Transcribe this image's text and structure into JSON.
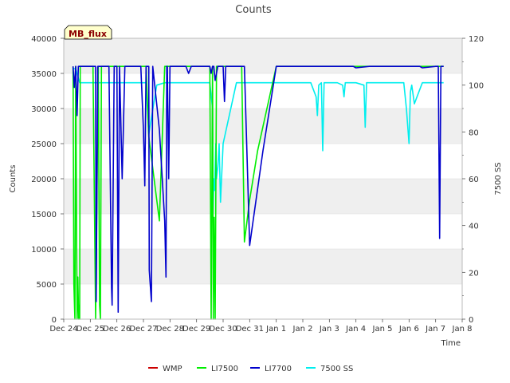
{
  "chart_data": {
    "type": "line",
    "title": "Counts",
    "xlabel": "Time",
    "ylabel": "Counts",
    "y2label": "7500 SS",
    "badge": "MB_flux",
    "x_ticks": [
      "Dec 24",
      "Dec 25",
      "Dec 26",
      "Dec 27",
      "Dec 28",
      "Dec 29",
      "Dec 30",
      "Dec 31",
      "Jan 1",
      "Jan 2",
      "Jan 3",
      "Jan 4",
      "Jan 5",
      "Jan 6",
      "Jan 7",
      "Jan 8"
    ],
    "x_range_days": [
      0,
      15
    ],
    "ylim": [
      0,
      40000
    ],
    "y_ticks": [
      0,
      5000,
      10000,
      15000,
      20000,
      25000,
      30000,
      35000,
      40000
    ],
    "y2lim": [
      0,
      120
    ],
    "y2_ticks": [
      0,
      20,
      40,
      60,
      80,
      100,
      120
    ],
    "grid": "horizontal bands",
    "legend_position": "bottom",
    "series": [
      {
        "name": "WMP",
        "color": "#cc0000",
        "axis": "left",
        "x": [],
        "values": []
      },
      {
        "name": "LI7500",
        "color": "#00ee00",
        "axis": "left",
        "x": [
          0.35,
          0.38,
          0.42,
          0.45,
          0.5,
          0.53,
          0.56,
          0.58,
          0.6,
          0.62,
          0.65,
          0.7,
          0.72,
          0.75,
          0.8,
          0.9,
          1.0,
          1.1,
          1.2,
          1.3,
          1.35,
          1.38,
          1.42,
          1.45,
          1.5,
          1.55,
          1.6,
          1.7,
          1.9,
          2.2,
          2.6,
          3.0,
          3.05,
          3.1,
          3.2,
          3.6,
          3.8,
          3.85,
          3.9,
          4.0,
          4.2,
          4.6,
          5.0,
          5.2,
          5.5,
          5.55,
          5.6,
          5.63,
          5.66,
          5.7,
          5.75,
          5.8,
          5.85,
          5.9,
          5.95,
          6.0,
          6.2,
          6.7,
          6.8,
          7.0,
          7.3,
          8.0,
          9.0,
          10.0,
          11.0,
          12.0,
          13.0,
          14.0,
          14.3
        ],
        "values": [
          36000,
          5000,
          0,
          36000,
          0,
          6000,
          0,
          2000,
          0,
          36000,
          36000,
          36000,
          36000,
          36000,
          36000,
          36000,
          36000,
          36000,
          0,
          36000,
          2000,
          0,
          36000,
          36000,
          36000,
          36000,
          36000,
          36000,
          36000,
          36000,
          36000,
          36000,
          36000,
          36000,
          26000,
          14000,
          36000,
          36000,
          36000,
          36000,
          36000,
          36000,
          36000,
          36000,
          36000,
          0,
          36000,
          0,
          14500,
          0,
          36000,
          36000,
          36000,
          36000,
          36000,
          36000,
          36000,
          36000,
          11000,
          17000,
          24000,
          36000,
          36000,
          36000,
          36000,
          36000,
          36000,
          36000,
          36000
        ]
      },
      {
        "name": "LI7700",
        "color": "#0000cc",
        "axis": "left",
        "x": [
          0.35,
          0.4,
          0.45,
          0.5,
          0.55,
          0.6,
          0.65,
          0.7,
          0.8,
          1.0,
          1.1,
          1.2,
          1.22,
          1.28,
          1.35,
          1.6,
          1.7,
          1.8,
          1.82,
          1.9,
          2.0,
          2.05,
          2.1,
          2.2,
          2.3,
          2.35,
          2.4,
          2.6,
          2.9,
          3.0,
          3.05,
          3.1,
          3.12,
          3.15,
          3.2,
          3.22,
          3.3,
          3.35,
          3.6,
          3.8,
          3.85,
          3.88,
          3.9,
          3.95,
          4.0,
          4.2,
          4.6,
          4.7,
          4.8,
          5.0,
          5.2,
          5.5,
          5.55,
          5.6,
          5.65,
          5.7,
          5.8,
          5.9,
          6.0,
          6.05,
          6.1,
          6.2,
          6.4,
          6.6,
          6.8,
          7.0,
          7.5,
          8.0,
          9.0,
          10.0,
          10.9,
          11.0,
          11.5,
          12.0,
          13.0,
          13.4,
          13.5,
          14.0,
          14.1,
          14.15,
          14.2,
          14.3
        ],
        "values": [
          36000,
          33000,
          36000,
          29000,
          36000,
          36000,
          36000,
          36000,
          36000,
          36000,
          36000,
          36000,
          2500,
          36000,
          36000,
          36000,
          36000,
          4500,
          2000,
          36000,
          36000,
          1000,
          36000,
          20000,
          36000,
          36000,
          36000,
          36000,
          36000,
          27000,
          19000,
          36000,
          36000,
          36000,
          36000,
          7000,
          2500,
          36000,
          27000,
          14000,
          6000,
          36000,
          36000,
          20000,
          36000,
          36000,
          36000,
          35000,
          36000,
          36000,
          36000,
          36000,
          35000,
          36000,
          36000,
          34000,
          36000,
          36000,
          36000,
          31000,
          36000,
          36000,
          36000,
          36000,
          36000,
          10500,
          24000,
          36000,
          36000,
          36000,
          36000,
          35800,
          36000,
          36000,
          36000,
          36000,
          35800,
          36000,
          36000,
          11500,
          36000,
          36000
        ]
      },
      {
        "name": "7500 SS",
        "color": "#00eeee",
        "axis": "right",
        "x": [
          0.35,
          0.45,
          0.6,
          0.8,
          1.0,
          1.3,
          1.5,
          2.0,
          2.15,
          2.3,
          2.6,
          2.7,
          2.8,
          3.0,
          3.1,
          3.2,
          3.5,
          3.8,
          3.9,
          4.2,
          4.5,
          4.7,
          4.8,
          5.0,
          5.3,
          5.5,
          5.6,
          5.62,
          5.65,
          5.68,
          5.72,
          5.75,
          5.8,
          5.85,
          5.9,
          6.0,
          6.5,
          6.8,
          7.0,
          7.5,
          8.0,
          8.5,
          9.0,
          9.3,
          9.5,
          9.55,
          9.6,
          9.7,
          9.75,
          9.8,
          10.0,
          10.3,
          10.5,
          10.55,
          10.6,
          10.8,
          11.0,
          11.3,
          11.35,
          11.4,
          11.5,
          11.8,
          12.0,
          12.3,
          12.5,
          12.8,
          12.9,
          13.0,
          13.05,
          13.1,
          13.2,
          13.3,
          13.5,
          13.7,
          14.0,
          14.3
        ],
        "values": [
          107,
          107,
          101,
          101,
          101,
          101,
          101,
          101,
          101,
          101,
          101,
          101,
          101,
          101,
          101,
          79,
          100,
          101,
          101,
          101,
          101,
          101,
          101,
          101,
          101,
          101,
          90,
          45,
          60,
          55,
          75,
          60,
          65,
          75,
          50,
          75,
          101,
          101,
          101,
          101,
          101,
          101,
          101,
          101,
          95,
          87,
          100,
          101,
          72,
          101,
          101,
          101,
          100,
          95,
          101,
          101,
          101,
          100,
          82,
          101,
          101,
          101,
          101,
          101,
          101,
          101,
          90,
          75,
          97,
          100,
          92,
          95,
          101,
          101,
          101,
          101
        ]
      }
    ]
  }
}
